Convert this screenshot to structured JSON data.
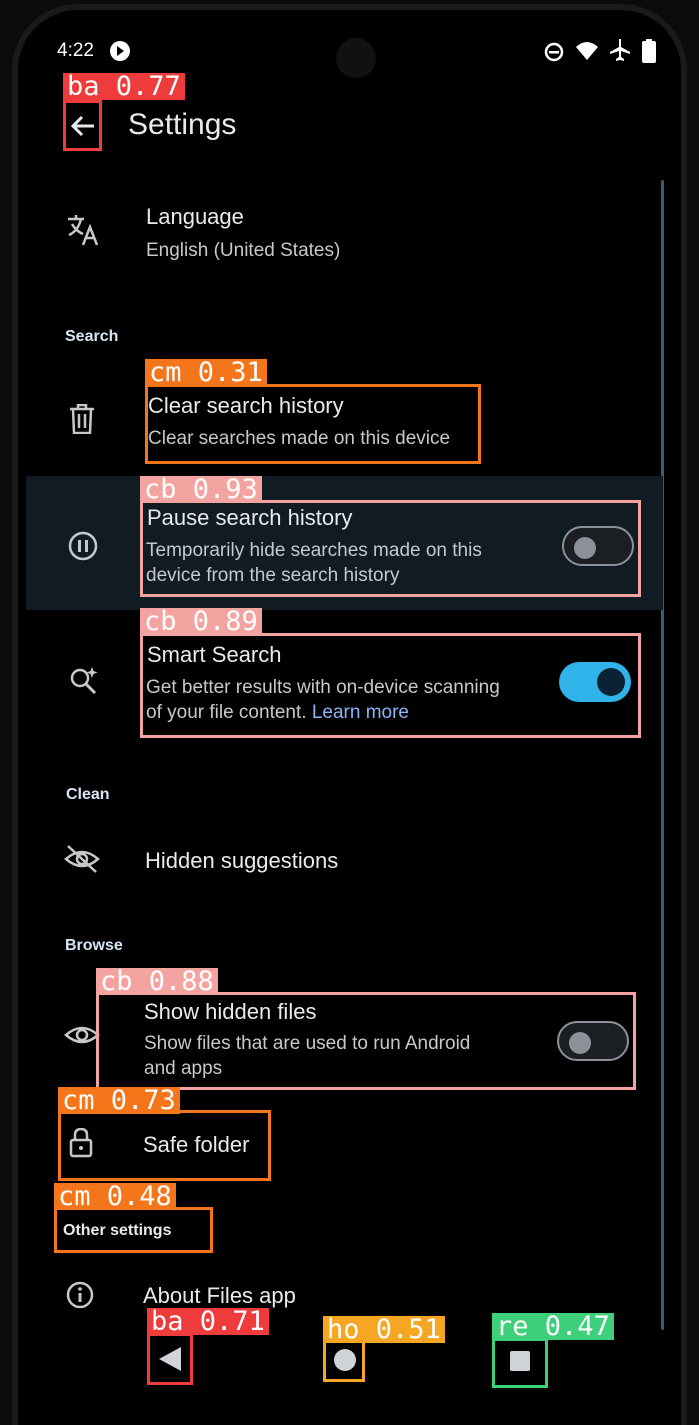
{
  "status_bar": {
    "time": "4:22"
  },
  "header": {
    "title": "Settings"
  },
  "language": {
    "title": "Language",
    "value": "English (United States)"
  },
  "sections": {
    "search": "Search",
    "clean": "Clean",
    "browse": "Browse"
  },
  "clear_history": {
    "title": "Clear search history",
    "subtitle": "Clear searches made on this device"
  },
  "pause_history": {
    "title": "Pause search history",
    "subtitle_line1": "Temporarily hide searches made on this",
    "subtitle_line2": "device from the search history",
    "enabled": false
  },
  "smart_search": {
    "title": "Smart Search",
    "subtitle_line1": "Get better results with on-device scanning",
    "subtitle_line2": "of your file content. ",
    "link": "Learn more",
    "enabled": true
  },
  "hidden_suggestions": {
    "title": "Hidden suggestions"
  },
  "show_hidden": {
    "title": "Show hidden files",
    "subtitle_line1": "Show files that are used to run Android",
    "subtitle_line2": "and apps",
    "enabled": false
  },
  "safe_folder": {
    "title": "Safe folder"
  },
  "other_settings": {
    "title": "Other settings"
  },
  "about": {
    "title": "About Files app"
  },
  "detections": [
    {
      "label": "ba 0.77",
      "color": "#ee3b3b"
    },
    {
      "label": "cm 0.31",
      "color": "#f5761a"
    },
    {
      "label": "cb 0.93",
      "color": "#f4a4a0"
    },
    {
      "label": "cb 0.89",
      "color": "#f4a4a0"
    },
    {
      "label": "cb 0.88",
      "color": "#f4a4a0"
    },
    {
      "label": "cm 0.73",
      "color": "#f5761a"
    },
    {
      "label": "cm 0.48",
      "color": "#f5761a"
    },
    {
      "label": "ba 0.71",
      "color": "#ee3b3b"
    },
    {
      "label": "ho 0.51",
      "color": "#f5a623"
    },
    {
      "label": "re 0.47",
      "color": "#3ecf7a"
    }
  ]
}
